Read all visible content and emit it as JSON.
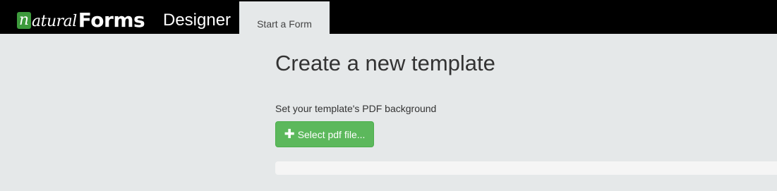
{
  "brand": {
    "logo_n": "n",
    "logo_script": "atural",
    "logo_forms": "Forms",
    "designer": "Designer"
  },
  "nav": {
    "tab_start_form": "Start a Form"
  },
  "main": {
    "title": "Create a new template",
    "pdf_label": "Set your template's PDF background",
    "select_button_label": "Select pdf file...",
    "upload_progress": 0
  },
  "colors": {
    "header_bg": "#000000",
    "page_bg": "#e5e8e9",
    "logo_accent": "#3d9a3c",
    "button_bg": "#5cb85c",
    "progress_track": "#f5f5f5"
  },
  "icons": {
    "button_icon": "plus-icon"
  }
}
